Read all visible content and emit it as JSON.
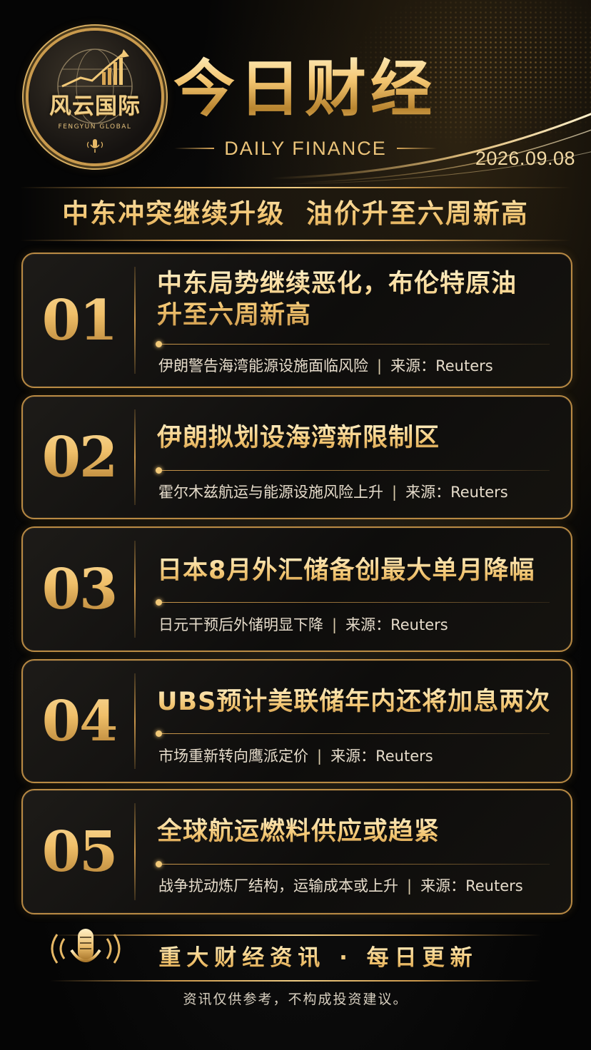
{
  "brand": {
    "name": "风云国际",
    "sub": "FENGYUN GLOBAL"
  },
  "header": {
    "title": "今日财经",
    "subtitle": "DAILY FINANCE",
    "date": "2026.09.08"
  },
  "headline": "中东冲突继续升级  油价升至六周新高",
  "news": [
    {
      "num": "01",
      "title": "中东局势继续恶化，布伦特原油升至六周新高",
      "summary": "伊朗警告海湾能源设施面临风险",
      "source": "来源：Reuters"
    },
    {
      "num": "02",
      "title": "伊朗拟划设海湾新限制区",
      "summary": "霍尔木兹航运与能源设施风险上升",
      "source": "来源：Reuters"
    },
    {
      "num": "03",
      "title": "日本8月外汇储备创最大单月降幅",
      "summary": "日元干预后外储明显下降",
      "source": "来源：Reuters"
    },
    {
      "num": "04",
      "title": "UBS预计美联储年内还将加息两次",
      "summary": "市场重新转向鹰派定价",
      "source": "来源：Reuters"
    },
    {
      "num": "05",
      "title": "全球航运燃料供应或趋紧",
      "summary": "战争扰动炼厂结构，运输成本或上升",
      "source": "来源：Reuters"
    }
  ],
  "separator": "|",
  "footer": {
    "slogan": "重大财经资讯 · 每日更新",
    "disclaimer": "资讯仅供参考，不构成投资建议。"
  },
  "colors": {
    "gold": "#e8c27a",
    "gold_light": "#fff0c6",
    "gold_dark": "#b98a44",
    "background": "#000000",
    "summary_text": "#e6dccb"
  },
  "icons": [
    "globe-chart-icon",
    "microphone-icon",
    "dot-bullet-icon"
  ]
}
